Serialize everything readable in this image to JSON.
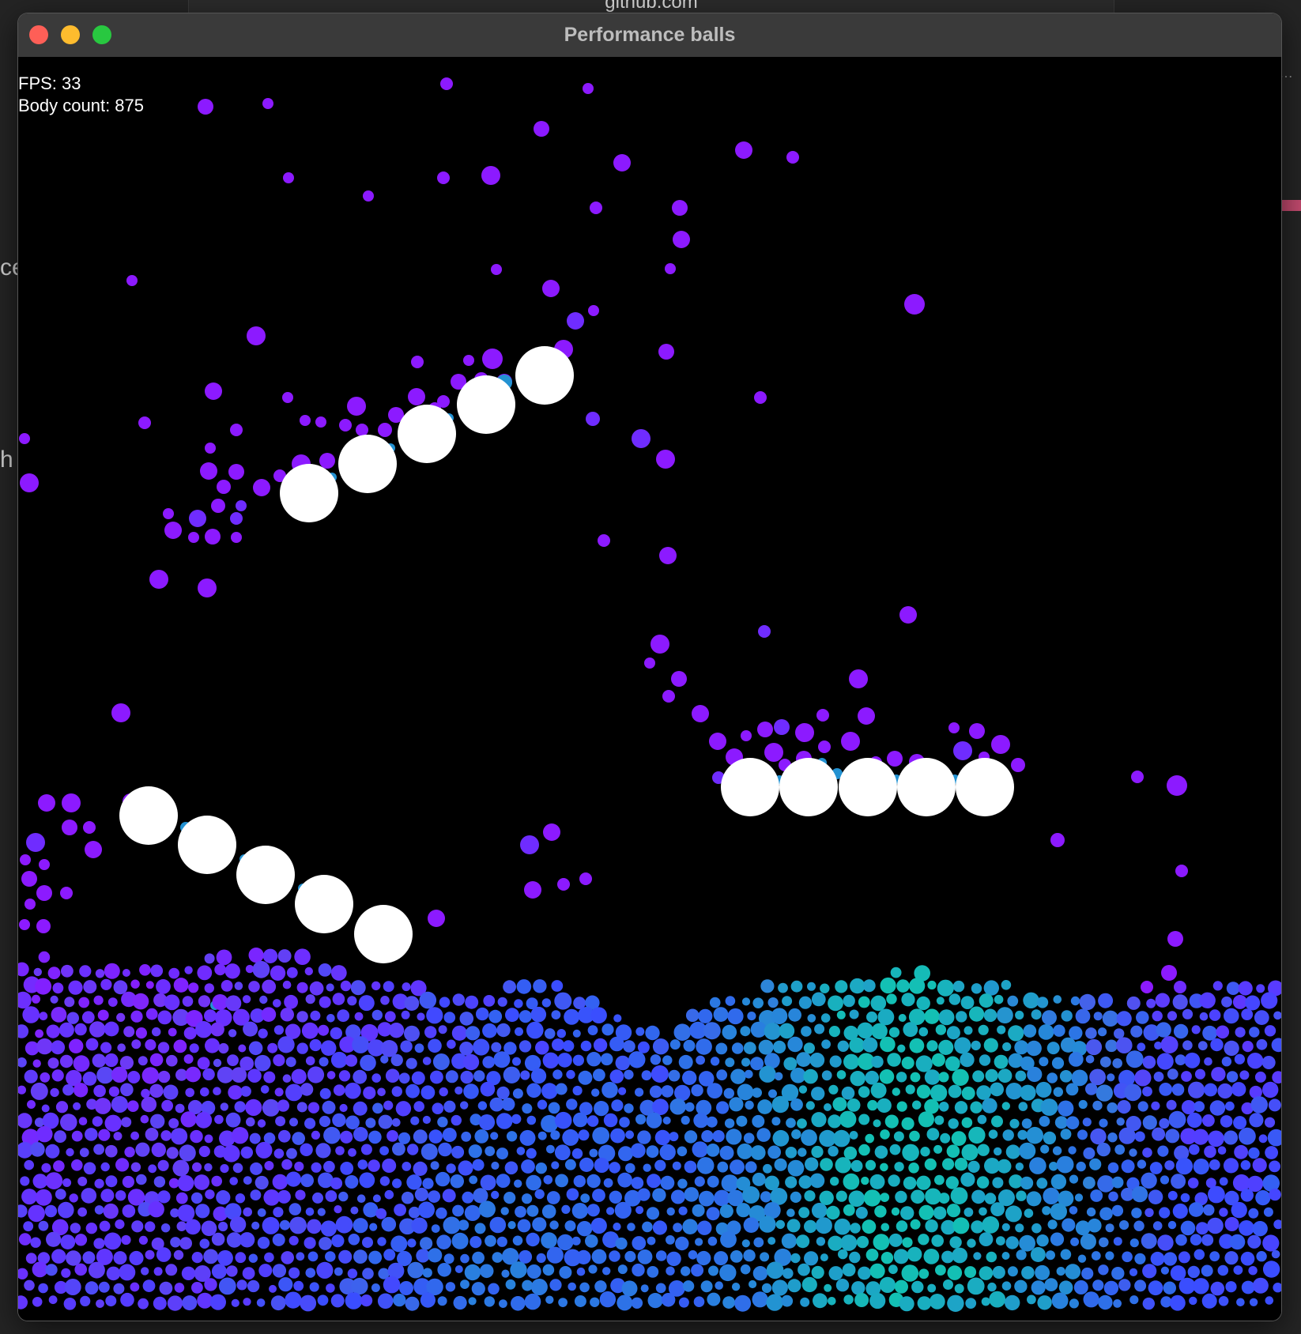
{
  "window": {
    "title": "Performance balls"
  },
  "background": {
    "url_text": "github.com"
  },
  "hud": {
    "fps_text": "FPS: 33",
    "body_count_text": "Body count: 875"
  },
  "colors": {
    "canvas": "#000000",
    "static_body": "#ffffff",
    "ball_purple": "#8c1aff",
    "ball_blue": "#3a4dff",
    "ball_teal": "#13c0b4"
  }
}
